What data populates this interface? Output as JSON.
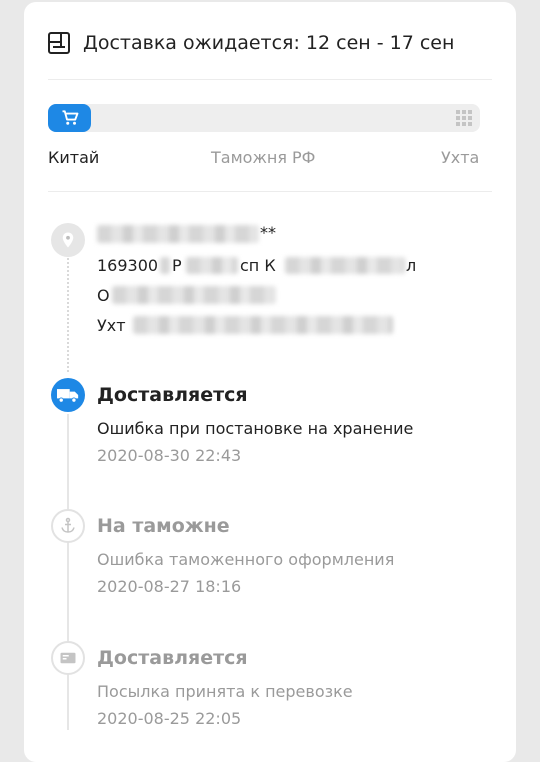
{
  "header": {
    "title": "Доставка ожидается: 12 сен - 17 сен",
    "icon": "calendar-box-icon"
  },
  "progress": {
    "fraction": 0.1,
    "accent": "#1e88e5",
    "stages": [
      "Китай",
      "Таможня РФ",
      "Ухта"
    ],
    "start_icon": "cart-icon",
    "end_icon": "grid-icon"
  },
  "address": {
    "icon": "location-pin-icon",
    "name_suffix": "**",
    "line1_start": "169300",
    "line1_mid": "Р",
    "line1_mid2": "сп К",
    "line1_end": "л",
    "line2_start": "О",
    "line3_start": "Ухт"
  },
  "events": [
    {
      "status": "Доставляется",
      "description": "Ошибка при постановке на хранение",
      "time": "2020-08-30 22:43",
      "icon": "truck-icon",
      "active": true
    },
    {
      "status": "На таможне",
      "description": "Ошибка таможенного оформления",
      "time": "2020-08-27 18:16",
      "icon": "anchor-icon",
      "active": false
    },
    {
      "status": "Доставляется",
      "description": "Посылка принята к перевозке",
      "time": "2020-08-25 22:05",
      "icon": "card-icon",
      "active": false
    }
  ]
}
